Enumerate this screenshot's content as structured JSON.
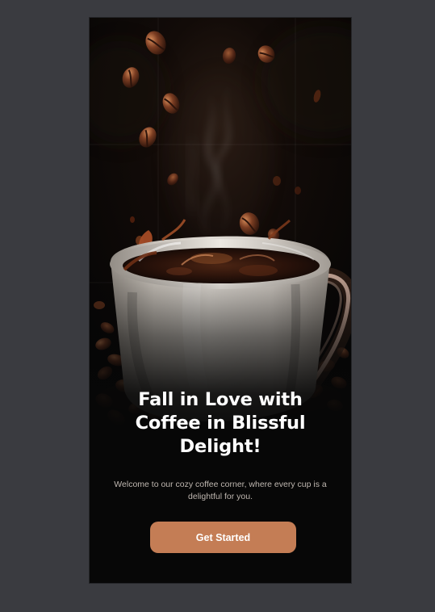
{
  "screen": {
    "title": "Fall in Love with Coffee in Blissful Delight!",
    "description": "Welcome to our cozy coffee corner, where every cup is a delightful for you.",
    "cta_label": "Get Started"
  },
  "hero": {
    "image": "coffee-cup-with-beans"
  },
  "colors": {
    "outer_background": "#3a3b40",
    "screen_background": "#070707",
    "title_text": "#ffffff",
    "body_text": "#bfb7b0",
    "button_background": "#c47d55",
    "button_text": "#ffffff"
  }
}
